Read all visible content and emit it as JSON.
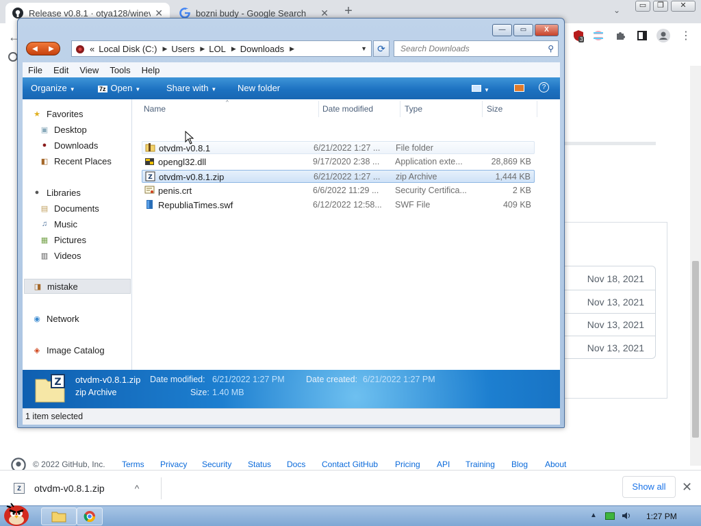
{
  "browser": {
    "tabs": [
      {
        "title": "Release v0.8.1 · otya128/winev",
        "favicon": "github-icon",
        "active": true
      },
      {
        "title": "bozni budy - Google Search",
        "favicon": "google-icon",
        "active": false
      }
    ],
    "new_tab": "+",
    "tab_search": "⌄",
    "window_controls": {
      "minimize": "▭",
      "restore": "❐",
      "close": "✕"
    },
    "extension_badge": "3",
    "menu": "⋮"
  },
  "github": {
    "release_dates": [
      "Nov 18, 2021",
      "Nov 13, 2021",
      "Nov 13, 2021",
      "Nov 13, 2021"
    ],
    "footer": {
      "copyright": "© 2022 GitHub, Inc.",
      "links": [
        "Terms",
        "Privacy",
        "Security",
        "Status",
        "Docs",
        "Contact GitHub",
        "Pricing",
        "API",
        "Training",
        "Blog",
        "About"
      ]
    }
  },
  "download_shelf": {
    "filename": "otvdm-v0.8.1.zip",
    "chevron": "^",
    "show_all": "Show all",
    "close": "✕"
  },
  "explorer": {
    "window_buttons": {
      "minimize": "—",
      "maximize": "▭",
      "close": "X"
    },
    "address": {
      "prefix": "«",
      "segments": [
        "Local Disk (C:)",
        "Users",
        "LOL",
        "Downloads"
      ]
    },
    "search_placeholder": "Search Downloads",
    "menu": [
      "File",
      "Edit",
      "View",
      "Tools",
      "Help"
    ],
    "commands": {
      "organize": "Organize",
      "open": "Open",
      "open_badge": "7z",
      "share_with": "Share with",
      "new_folder": "New folder"
    },
    "nav": {
      "favorites": "Favorites",
      "desktop": "Desktop",
      "downloads": "Downloads",
      "recent_places": "Recent Places",
      "libraries": "Libraries",
      "documents": "Documents",
      "music": "Music",
      "pictures": "Pictures",
      "videos": "Videos",
      "mistake": "mistake",
      "network": "Network",
      "image_catalog": "Image Catalog"
    },
    "columns": {
      "name": "Name",
      "date_modified": "Date modified",
      "type": "Type",
      "size": "Size"
    },
    "files": [
      {
        "name": "otvdm-v0.8.1",
        "date": "6/21/2022 1:27 ...",
        "type": "File folder",
        "size": "",
        "icon": "folder-icon"
      },
      {
        "name": "opengl32.dll",
        "date": "9/17/2020 2:38 ...",
        "type": "Application exte...",
        "size": "28,869 KB",
        "icon": "dll-icon"
      },
      {
        "name": "otvdm-v0.8.1.zip",
        "date": "6/21/2022 1:27 ...",
        "type": "zip Archive",
        "size": "1,444 KB",
        "icon": "7z-archive-icon"
      },
      {
        "name": "penis.crt",
        "date": "6/6/2022 11:29 ...",
        "type": "Security Certifica...",
        "size": "2 KB",
        "icon": "certificate-icon"
      },
      {
        "name": "RepubliaTimes.swf",
        "date": "6/12/2022 12:58...",
        "type": "SWF File",
        "size": "409 KB",
        "icon": "swf-icon"
      }
    ],
    "details": {
      "name": "otvdm-v0.8.1.zip",
      "type": "zip Archive",
      "date_modified_label": "Date modified:",
      "date_modified": "6/21/2022 1:27 PM",
      "date_created_label": "Date created:",
      "date_created": "6/21/2022 1:27 PM",
      "size_label": "Size:",
      "size": "1.40 MB"
    },
    "status": "1 item selected"
  },
  "taskbar": {
    "time": "1:27 PM"
  },
  "colors": {
    "command_bar": "#1d72c1",
    "selection": "#cfe2f7",
    "link": "#0969da"
  }
}
